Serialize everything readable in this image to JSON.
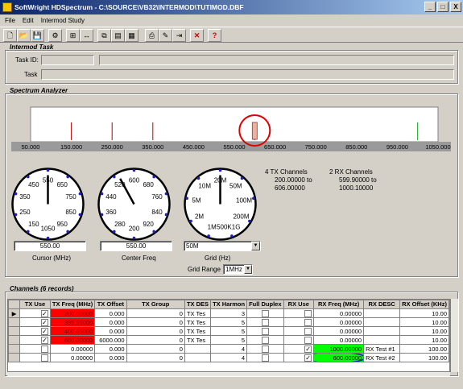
{
  "window": {
    "title": "SoftWright HDSpectrum - C:\\SOURCE\\VB32\\INTERMOD\\TUTIMOD.DBF",
    "minimize": "_",
    "maximize": "□",
    "close": "X"
  },
  "menu": [
    "File",
    "Edit",
    "Intermod Study"
  ],
  "toolbar_icons": [
    "new-icon",
    "open-icon",
    "save-icon",
    "tool-icon",
    "insert-icon",
    "swap-icon",
    "copy-icon",
    "page-icon",
    "page2-icon",
    "print-icon",
    "edit-icon",
    "export-icon",
    "delete-icon",
    "help-icon"
  ],
  "intermod_task": {
    "title": "Intermod Task",
    "task_id_label": "Task ID:",
    "task_label": "Task"
  },
  "spectrum": {
    "title": "Spectrum Analyzer",
    "ticks": [
      "50.000",
      "150.000",
      "250.000",
      "350.000",
      "450.000",
      "550.000",
      "650.000",
      "750.000",
      "850.000",
      "950.000",
      "1050.000"
    ],
    "markers": [
      {
        "freq": 150,
        "color": "#c00000"
      },
      {
        "freq": 250,
        "color": "#c00000"
      },
      {
        "freq": 350,
        "color": "#c00000"
      },
      {
        "freq": 600,
        "color": "#c00000"
      },
      {
        "freq": 1000,
        "color": "#00a000"
      }
    ],
    "cursor_freq": 600,
    "range_min": 50,
    "range_max": 1050
  },
  "dials": [
    {
      "labels": [
        "550",
        "650",
        "750",
        "850",
        "950",
        "1050",
        "150",
        "250",
        "350",
        "450"
      ],
      "field_value": "550.00",
      "field_label": "Cursor (MHz)"
    },
    {
      "labels": [
        "600",
        "680",
        "760",
        "840",
        "920",
        "200",
        "280",
        "360",
        "440",
        "520"
      ],
      "field_value": "550.00",
      "field_label": "Center Freq"
    },
    {
      "labels": [
        "20M",
        "50M",
        "100M",
        "200M",
        "500K1G",
        "1M",
        "2M",
        "5M",
        "10M"
      ],
      "field_value": "50M",
      "field_label": "Grid (Hz)"
    }
  ],
  "grid_range": {
    "label": "Grid Range",
    "value": "1MHz"
  },
  "tx_summary": {
    "line1": "4 TX Channels",
    "line2": "200.00000 to",
    "line3": "606.00000"
  },
  "rx_summary": {
    "line1": "2 RX Channels",
    "line2": "599.90000 to",
    "line3": "1000.10000"
  },
  "channels": {
    "title": "Channels (6 records)",
    "headers": [
      "TX Use",
      "TX Freq (MHz)",
      "TX Offset",
      "TX Group",
      "TX DES",
      "TX Harmon",
      "Full Duplex",
      "RX Use",
      "RX Freq (MHz)",
      "RX DESC",
      "RX Offset (KHz)"
    ],
    "rows": [
      {
        "tx_use": true,
        "tx_freq": "200.00000",
        "tx_offset": "0.000",
        "tx_group": "0",
        "tx_des": "TX Tes",
        "tx_harmon": "3",
        "rx_use": false,
        "rx_freq": "0.00000",
        "rx_desc": "",
        "rx_offset": "10.00"
      },
      {
        "tx_use": true,
        "tx_freq": "395.95000",
        "tx_offset": "0.000",
        "tx_group": "0",
        "tx_des": "TX Tes",
        "tx_harmon": "5",
        "rx_use": false,
        "rx_freq": "0.00000",
        "rx_desc": "",
        "rx_offset": "10.00"
      },
      {
        "tx_use": true,
        "tx_freq": "400.05000",
        "tx_offset": "0.000",
        "tx_group": "0",
        "tx_des": "TX Tes",
        "tx_harmon": "5",
        "rx_use": false,
        "rx_freq": "0.00000",
        "rx_desc": "",
        "rx_offset": "10.00"
      },
      {
        "tx_use": true,
        "tx_freq": "600.00000",
        "tx_offset": "6000.000",
        "tx_group": "0",
        "tx_des": "TX Tes",
        "tx_harmon": "5",
        "rx_use": false,
        "rx_freq": "0.00000",
        "rx_desc": "",
        "rx_offset": "10.00"
      },
      {
        "tx_use": false,
        "tx_freq": "0.00000",
        "tx_offset": "0.000",
        "tx_group": "0",
        "tx_des": "",
        "tx_harmon": "4",
        "rx_use": true,
        "rx_freq": "1000.00000",
        "rx_desc": "RX Test #1",
        "rx_offset": "100.00"
      },
      {
        "tx_use": false,
        "tx_freq": "0.00000",
        "tx_offset": "0.000",
        "tx_group": "0",
        "tx_des": "",
        "tx_harmon": "4",
        "rx_use": true,
        "rx_freq": "600.00000",
        "rx_desc": "RX Test #2",
        "rx_offset": "100.00"
      }
    ]
  }
}
